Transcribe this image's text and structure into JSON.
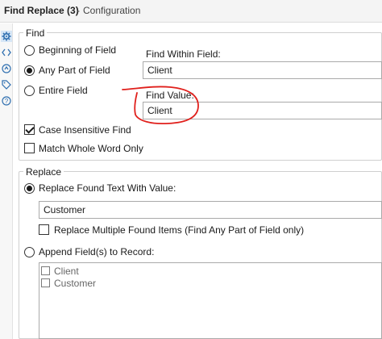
{
  "title": {
    "main": "Find Replace (3)",
    "separator": "-",
    "sub": "Configuration"
  },
  "sidebar": {
    "icons": [
      "gear-icon",
      "code-icon",
      "navigate-icon",
      "tag-icon",
      "help-icon"
    ]
  },
  "find": {
    "legend": "Find",
    "options": [
      {
        "label": "Beginning of Field",
        "checked": false
      },
      {
        "label": "Any Part of Field",
        "checked": true
      },
      {
        "label": "Entire Field",
        "checked": false
      }
    ],
    "find_within_label": "Find Within Field:",
    "find_within_value": "Client",
    "find_value_label": "Find Value:",
    "find_value_value": "Client",
    "case_insensitive": {
      "label": "Case Insensitive Find",
      "checked": true
    },
    "match_whole_word": {
      "label": "Match Whole Word Only",
      "checked": false
    }
  },
  "replace": {
    "legend": "Replace",
    "replace_found": {
      "label": "Replace Found Text With Value:",
      "checked": true
    },
    "replace_value": "Customer",
    "replace_multiple": {
      "label": "Replace Multiple Found Items (Find Any Part of Field only)",
      "checked": false
    },
    "append_fields": {
      "label": "Append Field(s) to Record:",
      "checked": false
    },
    "fields": [
      {
        "label": "Client",
        "checked": false
      },
      {
        "label": "Customer",
        "checked": false
      }
    ]
  },
  "colors": {
    "annotation": "#e0201c",
    "accent": "#2f6fb0"
  }
}
